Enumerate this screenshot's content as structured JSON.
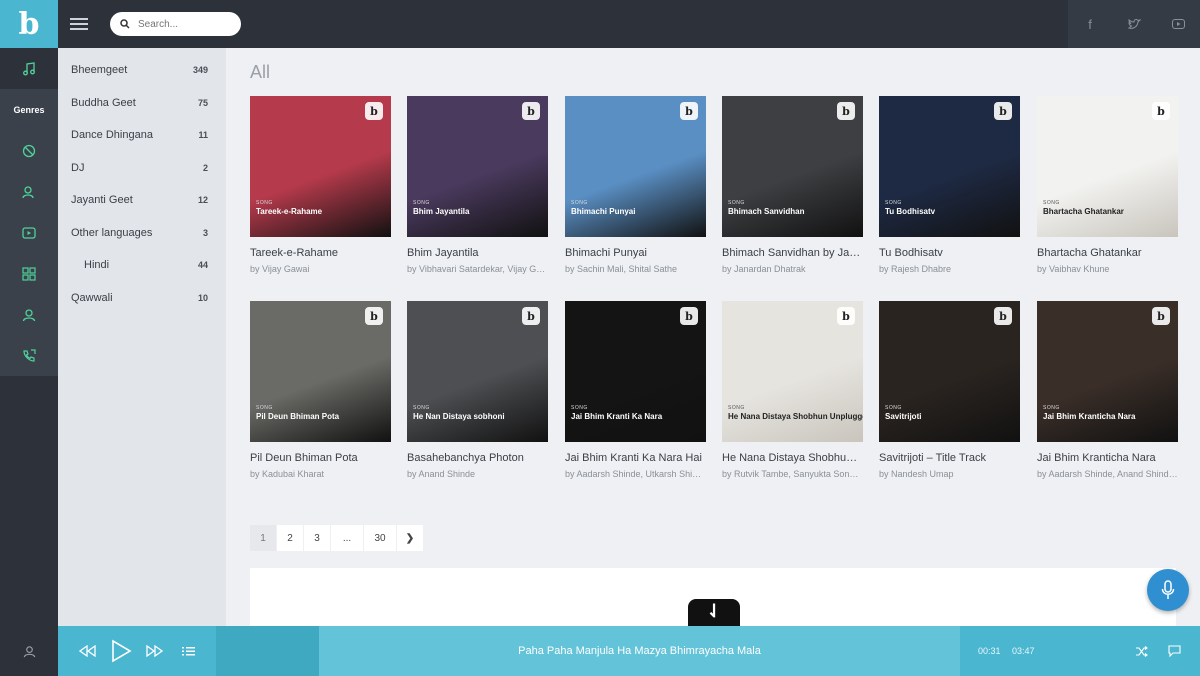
{
  "app": {
    "logo": "b"
  },
  "search": {
    "placeholder": "Search..."
  },
  "rail": {
    "items": [
      "music-note-icon",
      "genres",
      "disc-icon",
      "artist-icon",
      "video-icon",
      "grid-icon",
      "user-icon",
      "call-icon"
    ],
    "genres_label": "Genres"
  },
  "genres": [
    {
      "name": "Bheemgeet",
      "count": "349"
    },
    {
      "name": "Buddha Geet",
      "count": "75"
    },
    {
      "name": "Dance Dhingana",
      "count": "11"
    },
    {
      "name": "DJ",
      "count": "2"
    },
    {
      "name": "Jayanti Geet",
      "count": "12"
    },
    {
      "name": "Other languages",
      "count": "3"
    },
    {
      "name": "Hindi",
      "count": "44"
    },
    {
      "name": "Qawwali",
      "count": "10"
    }
  ],
  "main": {
    "heading": "All",
    "cards": [
      {
        "title": "Tareek-e-Rahame",
        "artist": "by Vijay Gawai",
        "cover_title": "Tareek-e-Rahame",
        "bg": "#b53a4b"
      },
      {
        "title": "Bhim Jayantila",
        "artist": "by Vibhavari Satardekar, Vijay Gawai, Santosh Vishwakar",
        "cover_title": "Bhim Jayantila",
        "bg": "#4a3a5e"
      },
      {
        "title": "Bhimachi Punyai",
        "artist": "by Sachin Mali, Shital Sathe",
        "cover_title": "Bhimachi Punyai",
        "bg": "#5a8fc4"
      },
      {
        "title": "Bhimach Sanvidhan by Janardan Dhatrak",
        "artist": "by Janardan Dhatrak",
        "cover_title": "Bhimach Sanvidhan",
        "bg": "#3d3f42"
      },
      {
        "title": "Tu Bodhisatv",
        "artist": "by Rajesh Dhabre",
        "cover_title": "Tu Bodhisatv",
        "bg": "#1e2a44"
      },
      {
        "title": "Bhartacha Ghatankar",
        "artist": "by Vaibhav Khune",
        "cover_title": "Bhartacha Ghatankar",
        "bg": "#f2f2f0"
      },
      {
        "title": "Pil Deun Bhiman Pota",
        "artist": "by Kadubai Kharat",
        "cover_title": "Pil Deun Bhiman Pota",
        "bg": "#6a6a66"
      },
      {
        "title": "Basahebanchya Photon",
        "artist": "by Anand Shinde",
        "cover_title": "He Nan Distaya sobhoni",
        "bg": "#4d4f52"
      },
      {
        "title": "Jai Bhim Kranti Ka Nara Hai",
        "artist": "by Aadarsh Shinde, Utkarsh Shinde",
        "cover_title": "Jai Bhim Kranti Ka Nara",
        "bg": "#141414"
      },
      {
        "title": "He Nana Distaya Shobhun Unplugged",
        "artist": "by Rutvik Tambe, Sanyukta Sonawane",
        "cover_title": "He Nana Distaya Shobhun Unplugged",
        "bg": "#e6e4df"
      },
      {
        "title": "Savitrijoti – Title Track",
        "artist": "by Nandesh Umap",
        "cover_title": "Savitrijoti",
        "bg": "#2a2420"
      },
      {
        "title": "Jai Bhim Kranticha Nara",
        "artist": "by Aadarsh Shinde, Anand Shinde, Utkarsh Shinde",
        "cover_title": "Jai Bhim Kranticha Nara",
        "bg": "#3a2e28"
      }
    ],
    "song_label": "SONG"
  },
  "pagination": {
    "pages": [
      "1",
      "2",
      "3",
      "...",
      "30"
    ],
    "next": "❯",
    "current": "1"
  },
  "player": {
    "now_playing": "Paha Paha Manjula Ha Mazya Bhimrayacha Mala",
    "elapsed": "00:31",
    "duration": "03:47"
  },
  "colors": {
    "accent": "#4ab6cf",
    "rail_bg": "#2c313a",
    "rail_icon": "#4ed39a",
    "mic": "#2f8fd0"
  }
}
